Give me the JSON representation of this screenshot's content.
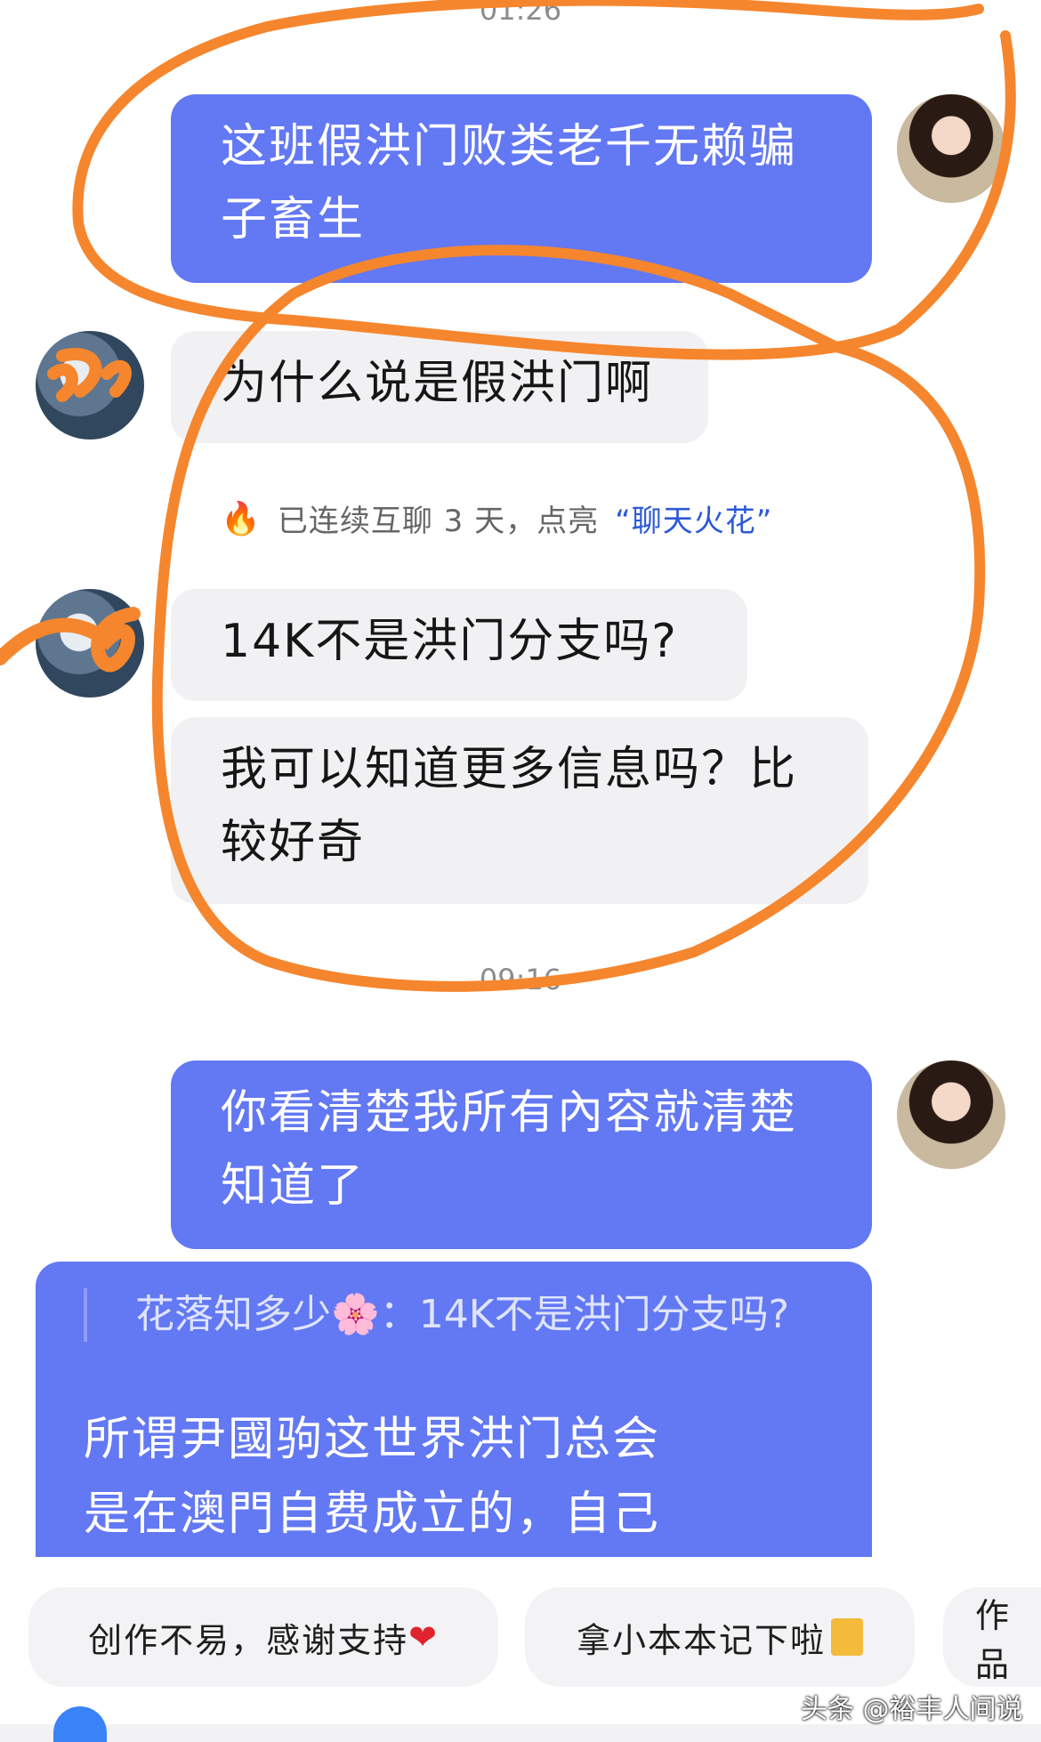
{
  "times": [
    "01:26",
    "09:16"
  ],
  "messages": {
    "m1": "这班假洪门败类老千无赖骗子畜生",
    "m2": "为什么说是假洪门啊",
    "m3": "14K不是洪门分支吗?",
    "m4": "我可以知道更多信息吗？比较好奇",
    "m5": "你看清楚我所有內容就清楚知道了",
    "quote": "花落知多少🌸：14K不是洪门分支吗?",
    "m6": "所谓尹國驹这世界洪门总会是在澳門自费成立的，自己"
  },
  "spark": {
    "prefix": "已连续互聊 3 天，点亮",
    "highlight": "“聊天火花”"
  },
  "chips": {
    "c1": "创作不易，感谢支持",
    "c2": "拿小本本记下啦",
    "c3": "作品"
  },
  "watermark": "头条 @裕丰人间说",
  "colors": {
    "sent_bubble": "#6378f3",
    "received_bubble": "#f1f1f3",
    "annotation": "#f5862e"
  },
  "icons": [
    "flame-icon",
    "blossom-icon",
    "heart-icon",
    "notebook-icon"
  ]
}
